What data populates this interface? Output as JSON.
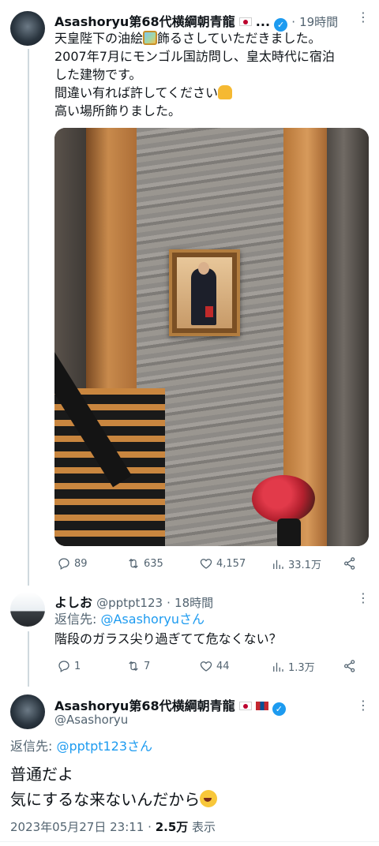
{
  "tweet": {
    "author_name": "Asashoryu第68代横綱朝青龍",
    "ellipsis": "...",
    "time": "19時間",
    "text_lines": [
      "天皇陛下の油絵",
      "飾るさしていただきました。",
      "2007年7月にモンゴル国訪問し、皇太時代に宿泊",
      "した建物です。",
      "間違い有れば許してください",
      "高い場所飾りました。"
    ],
    "stats": {
      "replies": "89",
      "retweets": "635",
      "likes": "4,157",
      "views": "33.1万"
    }
  },
  "reply": {
    "author_name": "よしお",
    "handle": "@pptpt123",
    "time": "18時間",
    "reply_to_prefix": "返信先: ",
    "reply_to_handle": "@Asashoryu",
    "reply_to_suffix": "さん",
    "text": "階段のガラス尖り過ぎてて危なくない？",
    "stats": {
      "replies": "1",
      "retweets": "7",
      "likes": "44",
      "views": "1.3万"
    }
  },
  "main": {
    "author_name": "Asashoryu第68代横綱朝青龍",
    "handle": "@Asashoryu",
    "reply_to_prefix": "返信先: ",
    "reply_to_handle": "@pptpt123",
    "reply_to_suffix": "さん",
    "text_lines": [
      "普通だよ",
      "気にするな来ないんだから"
    ],
    "timestamp": "2023年05月27日 23:11",
    "separator": "·",
    "views": "2.5万",
    "views_suffix": "表示"
  },
  "icons": {
    "more": "more-dots-icon",
    "reply": "reply-icon",
    "retweet": "retweet-icon",
    "like": "heart-icon",
    "views": "views-icon",
    "share": "share-icon",
    "verified": "verified-badge-icon"
  },
  "colors": {
    "link": "#1d9bf0",
    "muted": "#536471",
    "verified": "#1d9bf0"
  }
}
